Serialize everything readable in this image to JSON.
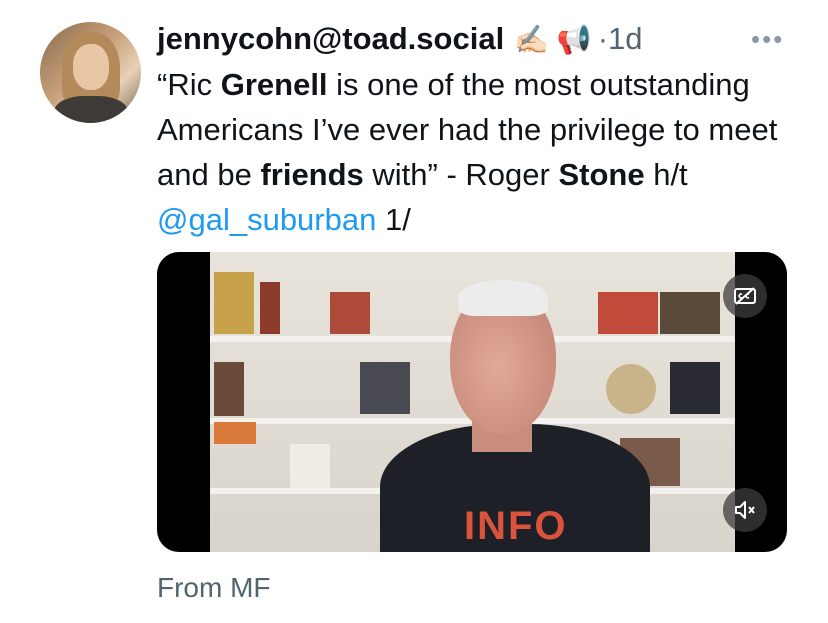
{
  "post": {
    "handle": "jennycohn@toad.social",
    "handle_emoji": "✍🏻 📢",
    "separator": "·",
    "time": "1d",
    "more_label": "•••",
    "text_parts": [
      {
        "text": "“Ric ",
        "bold": false
      },
      {
        "text": "Grenell",
        "bold": true
      },
      {
        "text": " is one of the most outstanding Americans I’ve ever had the privilege to meet and be ",
        "bold": false
      },
      {
        "text": "friends",
        "bold": true
      },
      {
        "text": " with” - Roger ",
        "bold": false
      },
      {
        "text": "Stone",
        "bold": true
      },
      {
        "text": " h/t ",
        "bold": false
      }
    ],
    "mention": "@gal_suburban",
    "suffix": " 1/",
    "source": "From MF"
  },
  "video": {
    "shirt_text": "INFO",
    "cc_icon": "captions-icon",
    "mute_icon": "muted-speaker-icon"
  },
  "colors": {
    "link": "#1d9bf0",
    "muted_text": "#536471",
    "text": "#0f1419"
  }
}
